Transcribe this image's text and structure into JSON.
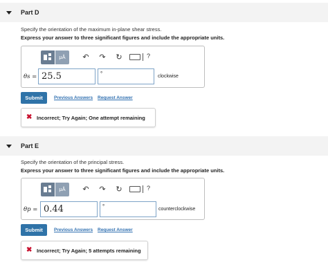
{
  "partD": {
    "title": "Part D",
    "instruction": "Specify the orientation of the maximum in-plane shear stress.",
    "emphasis": "Express your answer to three significant figures and include the appropriate units.",
    "toolbar": {
      "units_label": "μÅ",
      "help": "?"
    },
    "variable": "θs =",
    "value": "25.5",
    "unit_value": "°",
    "direction": "clockwise",
    "submit_label": "Submit",
    "previous_answers": "Previous Answers",
    "request_answer": "Request Answer",
    "feedback": "Incorrect; Try Again; One attempt remaining"
  },
  "partE": {
    "title": "Part E",
    "instruction": "Specify the orientation of the principal stress.",
    "emphasis": "Express your answer to three significant figures and include the appropriate units.",
    "toolbar": {
      "units_label": "μÅ",
      "help": "?"
    },
    "variable": "θp =",
    "value": "0.44",
    "unit_value": "°",
    "direction": "counterclockwise",
    "submit_label": "Submit",
    "previous_answers": "Previous Answers",
    "request_answer": "Request Answer",
    "feedback": "Incorrect; Try Again; 5 attempts remaining"
  },
  "icons": {
    "caret": "caret-down-icon",
    "undo": "undo-icon",
    "redo": "redo-icon",
    "reset": "reset-icon",
    "keyboard": "keyboard-icon",
    "help": "help-icon",
    "incorrect": "x-mark-icon"
  },
  "colors": {
    "accent": "#2f73a8",
    "error": "#c8102e",
    "link": "#2f6fb0",
    "header_bg": "#f3f3f3"
  }
}
